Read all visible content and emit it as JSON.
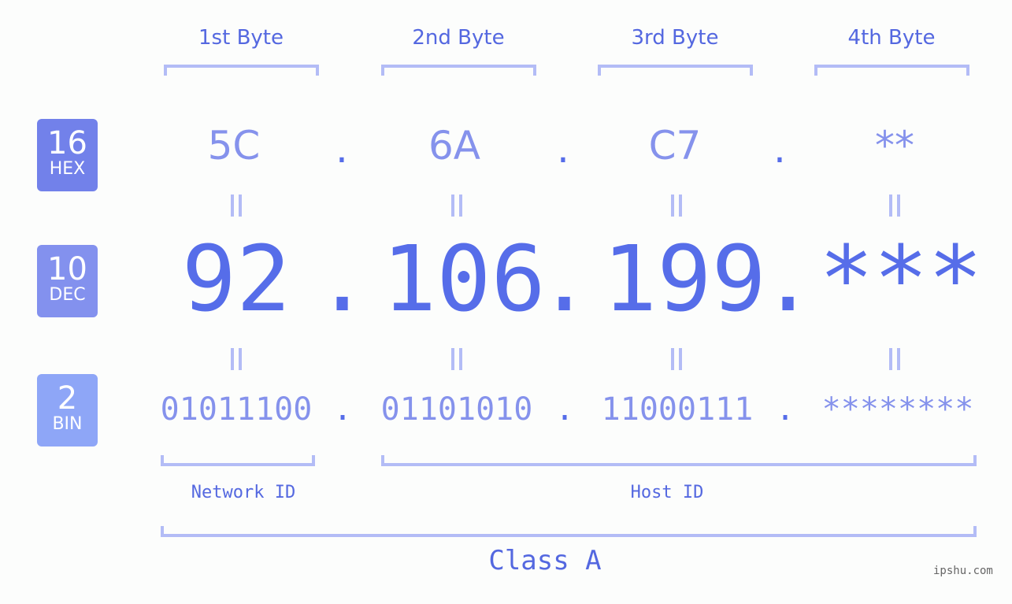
{
  "byte_headers": [
    "1st Byte",
    "2nd Byte",
    "3rd Byte",
    "4th Byte"
  ],
  "badges": [
    {
      "number": "16",
      "label": "HEX",
      "color": "#7281ea"
    },
    {
      "number": "10",
      "label": "DEC",
      "color": "#8391ee"
    },
    {
      "number": "2",
      "label": "BIN",
      "color": "#8ea6f7"
    }
  ],
  "hex": [
    "5C",
    "6A",
    "C7",
    "**"
  ],
  "dec": [
    "92",
    "106",
    "199",
    "***"
  ],
  "bin": [
    "01011100",
    "01101010",
    "11000111",
    "********"
  ],
  "separator": ".",
  "network_label": "Network ID",
  "host_label": "Host ID",
  "class_label": "Class A",
  "watermark": "ipshu.com",
  "colors": {
    "accent": "#566de9",
    "light_accent": "#8592ec",
    "bracket": "#b3bcf6"
  }
}
